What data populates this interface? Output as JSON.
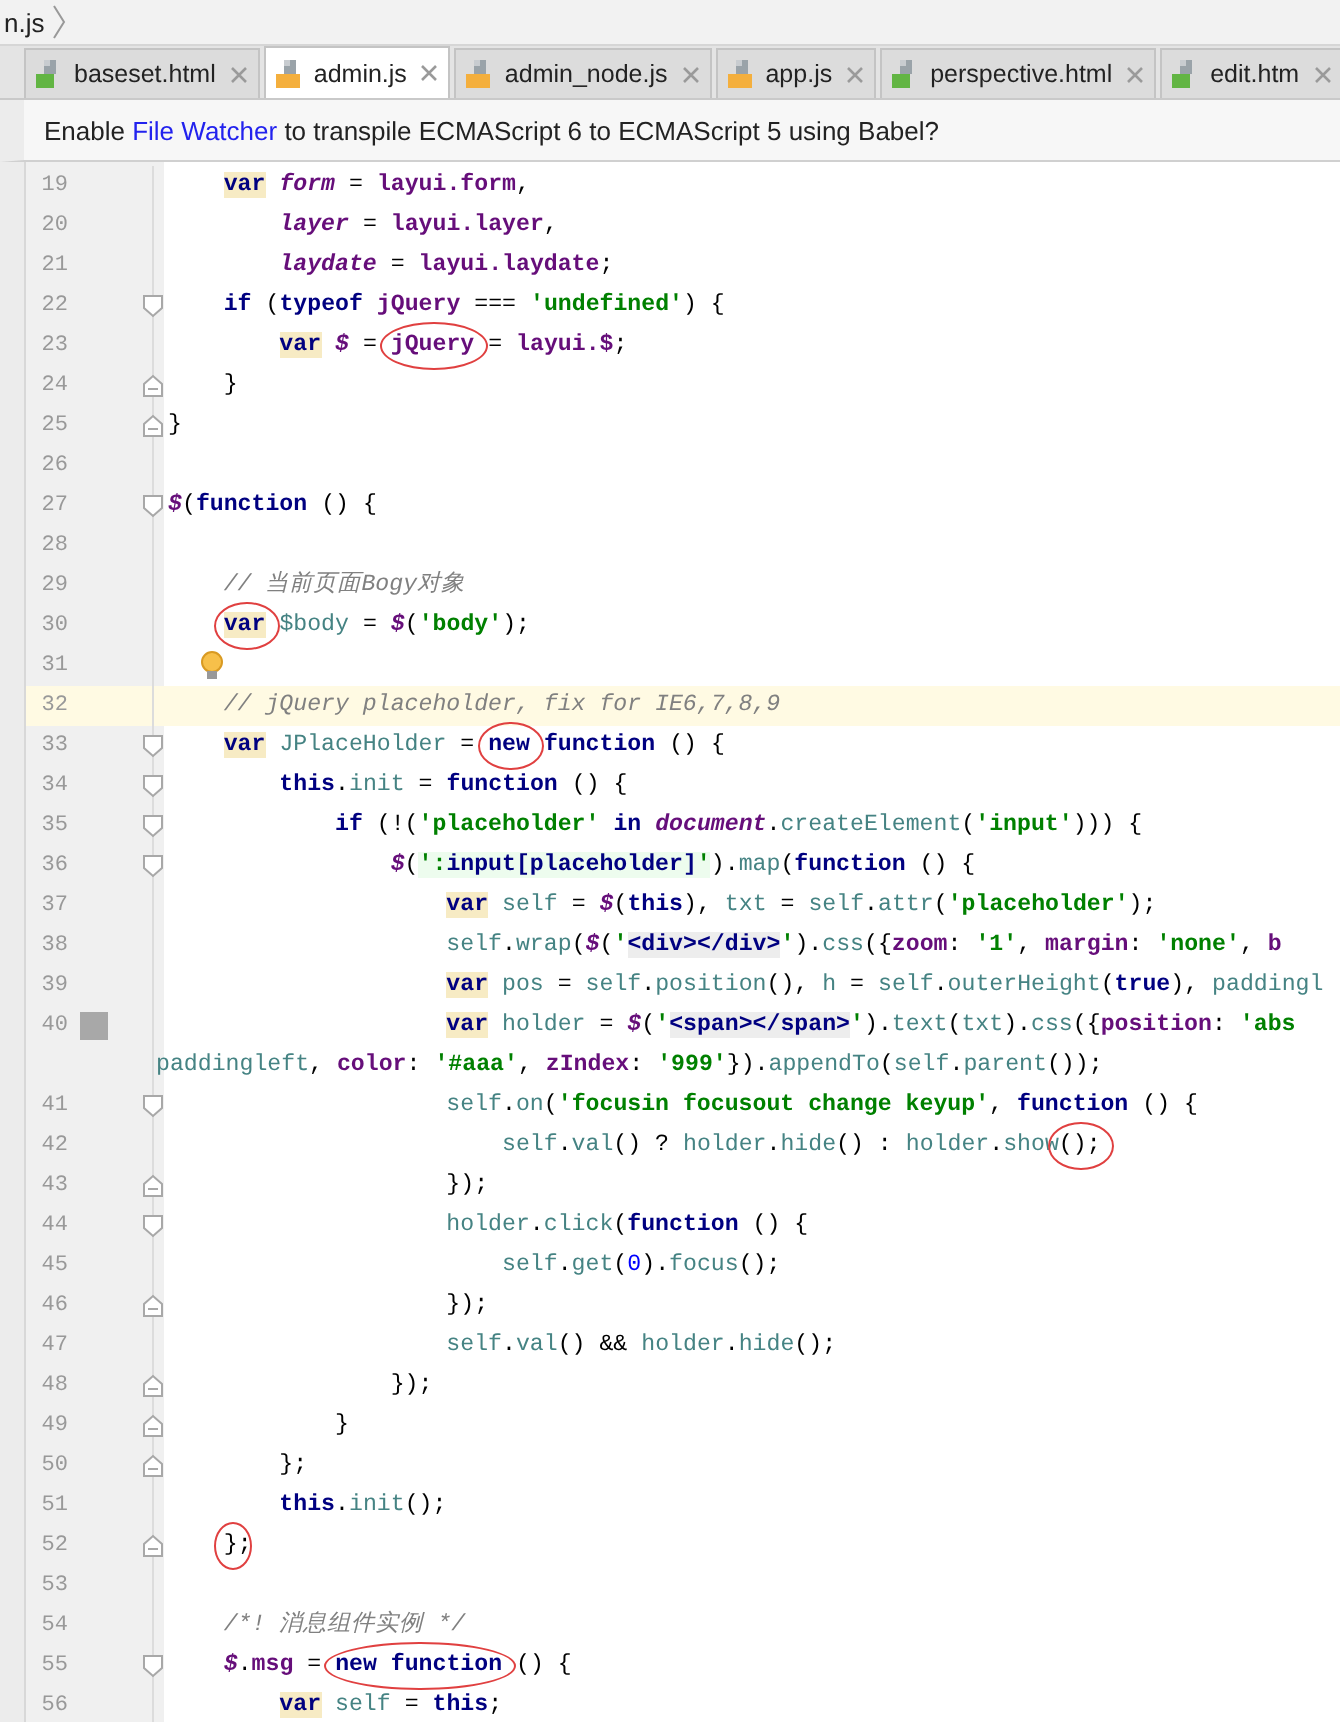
{
  "breadcrumb": {
    "text": "n.js"
  },
  "tabs": [
    {
      "label": "baseset.html",
      "kind": "html",
      "selected": false
    },
    {
      "label": "admin.js",
      "kind": "js",
      "selected": true
    },
    {
      "label": "admin_node.js",
      "kind": "js",
      "selected": false
    },
    {
      "label": "app.js",
      "kind": "js",
      "selected": false
    },
    {
      "label": "perspective.html",
      "kind": "html",
      "selected": false
    },
    {
      "label": "edit.htm",
      "kind": "html",
      "selected": false
    }
  ],
  "banner": {
    "before": "Enable",
    "link": "File Watcher",
    "after": "to transpile ECMAScript 6 to ECMAScript 5 using Babel?"
  },
  "lines": [
    {
      "number": "19",
      "current": false,
      "tokens": [
        {
          "t": "    var",
          "kind": "kh"
        },
        {
          "t": " form",
          "kind": "v"
        },
        {
          "t": " ="
        },
        {
          "t": " layui.form",
          "kind": "p"
        },
        {
          "t": ","
        }
      ]
    },
    {
      "number": "20",
      "current": false,
      "tokens": [
        {
          "t": "        layer",
          "kind": "v"
        },
        {
          "t": " ="
        },
        {
          "t": " layui.layer",
          "kind": "p"
        },
        {
          "t": ","
        }
      ]
    },
    {
      "number": "21",
      "current": false,
      "tokens": [
        {
          "t": "        laydate",
          "kind": "v"
        },
        {
          "t": " ="
        },
        {
          "t": " layui.laydate",
          "kind": "p"
        },
        {
          "t": ";"
        }
      ]
    },
    {
      "number": "22",
      "current": false,
      "fold": {
        "kind": "open"
      },
      "tokens": [
        {
          "t": "    if",
          "kind": "k"
        },
        {
          "t": " ("
        },
        {
          "t": "typeof",
          "kind": "k"
        },
        {
          "t": " jQuery",
          "kind": "p"
        },
        {
          "t": " ==="
        },
        {
          "t": " 'undefined'",
          "kind": "s"
        },
        {
          "t": ") {"
        }
      ]
    },
    {
      "number": "23",
      "current": false,
      "tokens": [
        {
          "t": "        var",
          "kind": "kh"
        },
        {
          "t": " $",
          "kind": "v"
        },
        {
          "t": " ="
        },
        {
          "t": " jQuery",
          "kind": "p",
          "circled": true
        },
        {
          "t": " ="
        },
        {
          "t": " layui.$",
          "kind": "p"
        },
        {
          "t": ";"
        }
      ]
    },
    {
      "number": "24",
      "current": false,
      "fold": {
        "kind": "close"
      },
      "tokens": [
        {
          "t": "    }"
        }
      ]
    },
    {
      "number": "25",
      "current": false,
      "fold": {
        "kind": "close"
      },
      "tokens": [
        {
          "t": "}"
        }
      ]
    },
    {
      "number": "26",
      "current": false
    },
    {
      "number": "27",
      "current": false,
      "fold": {
        "kind": "open"
      },
      "tokens": [
        {
          "t": "$",
          "kind": "v"
        },
        {
          "t": "("
        },
        {
          "t": "function",
          "kind": "k"
        },
        {
          "t": " () {"
        }
      ]
    },
    {
      "number": "28",
      "current": false
    },
    {
      "number": "29",
      "current": false,
      "tokens": [
        {
          "t": "    // 当前页面Bogy对象",
          "kind": "c"
        }
      ]
    },
    {
      "number": "30",
      "current": false,
      "tokens": [
        {
          "t": "    var",
          "kind": "kh",
          "circled": true
        },
        {
          "t": " $body",
          "kind": "l"
        },
        {
          "t": " ="
        },
        {
          "t": " $",
          "kind": "v"
        },
        {
          "t": "("
        },
        {
          "t": "'body'",
          "kind": "s"
        },
        {
          "t": ");"
        }
      ]
    },
    {
      "number": "31",
      "current": false,
      "marker": {
        "kind": "bulb"
      }
    },
    {
      "number": "32",
      "current": true,
      "tokens": [
        {
          "t": "    // jQuery placeholder, fix for IE6,7,8,9",
          "kind": "c"
        }
      ]
    },
    {
      "number": "33",
      "current": false,
      "fold": {
        "kind": "open"
      },
      "tokens": [
        {
          "t": "    var",
          "kind": "kh"
        },
        {
          "t": " JPlaceHolder",
          "kind": "l"
        },
        {
          "t": " ="
        },
        {
          "t": " new",
          "kind": "k",
          "circled": true
        },
        {
          "t": " function",
          "kind": "k"
        },
        {
          "t": " () {"
        }
      ]
    },
    {
      "number": "34",
      "current": false,
      "fold": {
        "kind": "open"
      },
      "tokens": [
        {
          "t": "        this",
          "kind": "k"
        },
        {
          "t": "."
        },
        {
          "t": "init",
          "kind": "l"
        },
        {
          "t": " ="
        },
        {
          "t": " function",
          "kind": "k"
        },
        {
          "t": " () {"
        }
      ]
    },
    {
      "number": "35",
      "current": false,
      "fold": {
        "kind": "open"
      },
      "tokens": [
        {
          "t": "            if",
          "kind": "k"
        },
        {
          "t": " (!("
        },
        {
          "t": "'placeholder'",
          "kind": "s"
        },
        {
          "t": " in",
          "kind": "k"
        },
        {
          "t": " document",
          "kind": "v"
        },
        {
          "t": "."
        },
        {
          "t": "createElement",
          "kind": "l"
        },
        {
          "t": "("
        },
        {
          "t": "'input'",
          "kind": "s"
        },
        {
          "t": "))) {"
        }
      ]
    },
    {
      "number": "36",
      "current": false,
      "fold": {
        "kind": "open"
      },
      "tokens": [
        {
          "t": "                $",
          "kind": "v"
        },
        {
          "t": "("
        },
        {
          "t": "':",
          "kind": "si"
        },
        {
          "t": "input[placeholder]",
          "kind": "ki"
        },
        {
          "t": "'",
          "kind": "si"
        },
        {
          "t": ")."
        },
        {
          "t": "map",
          "kind": "l"
        },
        {
          "t": "("
        },
        {
          "t": "function",
          "kind": "k"
        },
        {
          "t": " () {"
        }
      ]
    },
    {
      "number": "37",
      "current": false,
      "tokens": [
        {
          "t": "                    var",
          "kind": "kh"
        },
        {
          "t": " self",
          "kind": "l"
        },
        {
          "t": " ="
        },
        {
          "t": " $",
          "kind": "v"
        },
        {
          "t": "("
        },
        {
          "t": "this",
          "kind": "k"
        },
        {
          "t": "),"
        },
        {
          "t": " txt",
          "kind": "l"
        },
        {
          "t": " ="
        },
        {
          "t": " self",
          "kind": "l"
        },
        {
          "t": "."
        },
        {
          "t": "attr",
          "kind": "l"
        },
        {
          "t": "("
        },
        {
          "t": "'placeholder'",
          "kind": "s"
        },
        {
          "t": ");"
        }
      ]
    },
    {
      "number": "38",
      "current": false,
      "tokens": [
        {
          "t": "                    self",
          "kind": "l"
        },
        {
          "t": "."
        },
        {
          "t": "wrap",
          "kind": "l"
        },
        {
          "t": "("
        },
        {
          "t": "$",
          "kind": "v"
        },
        {
          "t": "("
        },
        {
          "t": "'",
          "kind": "s"
        },
        {
          "t": "<div></div>",
          "kind": "kg"
        },
        {
          "t": "'",
          "kind": "s"
        },
        {
          "t": ")."
        },
        {
          "t": "css",
          "kind": "l"
        },
        {
          "t": "({"
        },
        {
          "t": "zoom",
          "kind": "p"
        },
        {
          "t": ":"
        },
        {
          "t": " '1'",
          "kind": "s"
        },
        {
          "t": ","
        },
        {
          "t": " margin",
          "kind": "p"
        },
        {
          "t": ":"
        },
        {
          "t": " 'none'",
          "kind": "s"
        },
        {
          "t": ","
        },
        {
          "t": " b",
          "kind": "p"
        }
      ]
    },
    {
      "number": "39",
      "current": false,
      "tokens": [
        {
          "t": "                    var",
          "kind": "kh"
        },
        {
          "t": " pos",
          "kind": "l"
        },
        {
          "t": " ="
        },
        {
          "t": " self",
          "kind": "l"
        },
        {
          "t": "."
        },
        {
          "t": "position",
          "kind": "l"
        },
        {
          "t": "(),"
        },
        {
          "t": " h",
          "kind": "l"
        },
        {
          "t": " ="
        },
        {
          "t": " self",
          "kind": "l"
        },
        {
          "t": "."
        },
        {
          "t": "outerHeight",
          "kind": "l"
        },
        {
          "t": "("
        },
        {
          "t": "true",
          "kind": "k"
        },
        {
          "t": "),"
        },
        {
          "t": " paddingl",
          "kind": "l"
        }
      ]
    },
    {
      "number": "40",
      "current": false,
      "marker": {
        "kind": "bookmark"
      },
      "tokens": [
        {
          "t": "                    var",
          "kind": "kh"
        },
        {
          "t": " holder",
          "kind": "l"
        },
        {
          "t": " ="
        },
        {
          "t": " $",
          "kind": "v"
        },
        {
          "t": "("
        },
        {
          "t": "'",
          "kind": "s"
        },
        {
          "t": "<span></span>",
          "kind": "kg"
        },
        {
          "t": "'",
          "kind": "s"
        },
        {
          "t": ")."
        },
        {
          "t": "text",
          "kind": "l"
        },
        {
          "t": "("
        },
        {
          "t": "txt",
          "kind": "l"
        },
        {
          "t": ")."
        },
        {
          "t": "css",
          "kind": "l"
        },
        {
          "t": "({"
        },
        {
          "t": "position",
          "kind": "p"
        },
        {
          "t": ":"
        },
        {
          "t": " 'abs",
          "kind": "s"
        }
      ],
      "wrap": [
        {
          "t": "paddingleft",
          "kind": "l"
        },
        {
          "t": ","
        },
        {
          "t": " color",
          "kind": "p"
        },
        {
          "t": ":"
        },
        {
          "t": " '#aaa'",
          "kind": "s"
        },
        {
          "t": ","
        },
        {
          "t": " zIndex",
          "kind": "p"
        },
        {
          "t": ":"
        },
        {
          "t": " '999'",
          "kind": "s"
        },
        {
          "t": "})."
        },
        {
          "t": "appendTo",
          "kind": "l"
        },
        {
          "t": "("
        },
        {
          "t": "self",
          "kind": "l"
        },
        {
          "t": "."
        },
        {
          "t": "parent",
          "kind": "l"
        },
        {
          "t": "());"
        }
      ]
    },
    {
      "number": "41",
      "current": false,
      "fold": {
        "kind": "open"
      },
      "tokens": [
        {
          "t": "                    self",
          "kind": "l"
        },
        {
          "t": "."
        },
        {
          "t": "on",
          "kind": "l"
        },
        {
          "t": "("
        },
        {
          "t": "'focusin focusout change keyup'",
          "kind": "s"
        },
        {
          "t": ","
        },
        {
          "t": " function",
          "kind": "k"
        },
        {
          "t": " () {"
        }
      ]
    },
    {
      "number": "42",
      "current": false,
      "tokens": [
        {
          "t": "                        self",
          "kind": "l"
        },
        {
          "t": "."
        },
        {
          "t": "val",
          "kind": "l"
        },
        {
          "t": "() ?"
        },
        {
          "t": " holder",
          "kind": "l"
        },
        {
          "t": "."
        },
        {
          "t": "hide",
          "kind": "l"
        },
        {
          "t": "() :"
        },
        {
          "t": " holder",
          "kind": "l"
        },
        {
          "t": "."
        },
        {
          "t": "show",
          "kind": "l"
        },
        {
          "t": "();",
          "circled": true
        }
      ]
    },
    {
      "number": "43",
      "current": false,
      "fold": {
        "kind": "close"
      },
      "tokens": [
        {
          "t": "                    });"
        }
      ]
    },
    {
      "number": "44",
      "current": false,
      "fold": {
        "kind": "open"
      },
      "tokens": [
        {
          "t": "                    holder",
          "kind": "l"
        },
        {
          "t": "."
        },
        {
          "t": "click",
          "kind": "l"
        },
        {
          "t": "("
        },
        {
          "t": "function",
          "kind": "k"
        },
        {
          "t": " () {"
        }
      ]
    },
    {
      "number": "45",
      "current": false,
      "tokens": [
        {
          "t": "                        self",
          "kind": "l"
        },
        {
          "t": "."
        },
        {
          "t": "get",
          "kind": "l"
        },
        {
          "t": "("
        },
        {
          "t": "0",
          "kind": "n"
        },
        {
          "t": ")."
        },
        {
          "t": "focus",
          "kind": "l"
        },
        {
          "t": "();"
        }
      ]
    },
    {
      "number": "46",
      "current": false,
      "fold": {
        "kind": "close"
      },
      "tokens": [
        {
          "t": "                    });"
        }
      ]
    },
    {
      "number": "47",
      "current": false,
      "tokens": [
        {
          "t": "                    self",
          "kind": "l"
        },
        {
          "t": "."
        },
        {
          "t": "val",
          "kind": "l"
        },
        {
          "t": "() &&"
        },
        {
          "t": " holder",
          "kind": "l"
        },
        {
          "t": "."
        },
        {
          "t": "hide",
          "kind": "l"
        },
        {
          "t": "();"
        }
      ]
    },
    {
      "number": "48",
      "current": false,
      "fold": {
        "kind": "close"
      },
      "tokens": [
        {
          "t": "                });"
        }
      ]
    },
    {
      "number": "49",
      "current": false,
      "fold": {
        "kind": "close"
      },
      "tokens": [
        {
          "t": "            }"
        }
      ]
    },
    {
      "number": "50",
      "current": false,
      "fold": {
        "kind": "close"
      },
      "tokens": [
        {
          "t": "        };"
        }
      ]
    },
    {
      "number": "51",
      "current": false,
      "tokens": [
        {
          "t": "        this",
          "kind": "k"
        },
        {
          "t": "."
        },
        {
          "t": "init",
          "kind": "l"
        },
        {
          "t": "();"
        }
      ]
    },
    {
      "number": "52",
      "current": false,
      "fold": {
        "kind": "close"
      },
      "tokens": [
        {
          "t": "    }",
          "circled": true
        },
        {
          "t": ";"
        }
      ]
    },
    {
      "number": "53",
      "current": false
    },
    {
      "number": "54",
      "current": false,
      "tokens": [
        {
          "t": "    /*! 消息组件实例 */",
          "kind": "c"
        }
      ]
    },
    {
      "number": "55",
      "current": false,
      "fold": {
        "kind": "open"
      },
      "tokens": [
        {
          "t": "    $",
          "kind": "v"
        },
        {
          "t": "."
        },
        {
          "t": "msg",
          "kind": "p"
        },
        {
          "t": " ="
        },
        {
          "t": " new function",
          "kind": "k",
          "circled": true
        },
        {
          "t": " () {"
        }
      ]
    },
    {
      "number": "56",
      "current": false,
      "tokens": [
        {
          "t": "        var",
          "kind": "kh"
        },
        {
          "t": " self",
          "kind": "l"
        },
        {
          "t": " ="
        },
        {
          "t": " this",
          "kind": "k"
        },
        {
          "t": ";"
        }
      ]
    }
  ]
}
